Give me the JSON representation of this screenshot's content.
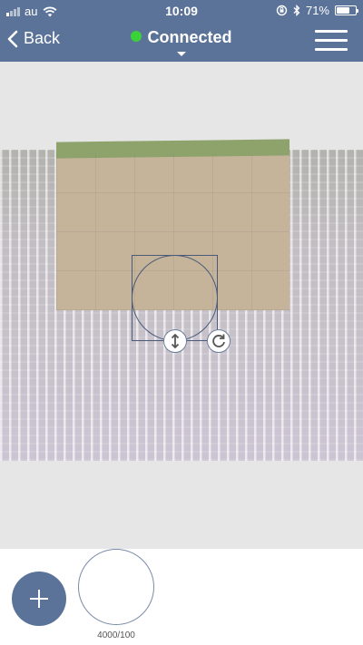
{
  "status_bar": {
    "carrier": "au",
    "time": "10:09",
    "battery": "71%",
    "battery_level": 0.71
  },
  "nav": {
    "back_label": "Back",
    "connection_label": "Connected"
  },
  "presets": [
    {
      "label": "4000/100"
    }
  ],
  "colors": {
    "bar": "#5b7399",
    "connected_dot": "#39d339"
  }
}
